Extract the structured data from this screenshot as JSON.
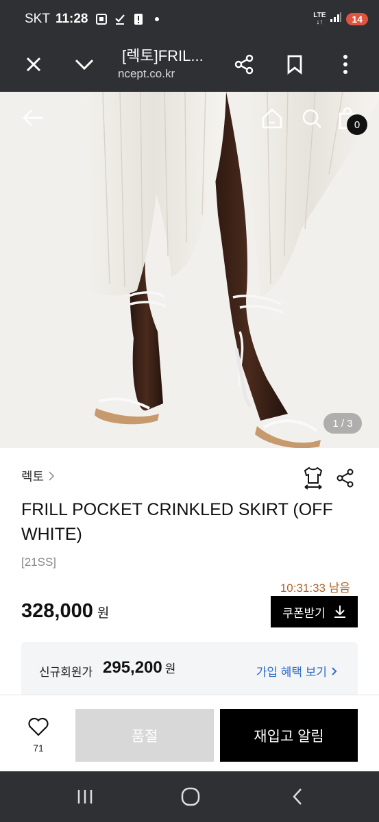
{
  "status_bar": {
    "carrier": "SKT",
    "time": "11:28",
    "network": "LTE",
    "battery": "14"
  },
  "browser": {
    "tab_title": "[렉토]FRIL...",
    "url": "ncept.co.kr"
  },
  "hero": {
    "cart_count": "0",
    "pager": "1 / 3"
  },
  "product": {
    "brand": "렉토",
    "title": "FRILL POCKET CRINKLED SKIRT (OFF WHITE)",
    "season": "[21SS]",
    "timer": "10:31:33 남음",
    "price": "328,000",
    "currency": "원",
    "coupon_label": "쿠폰받기"
  },
  "member": {
    "label": "신규회원가",
    "price": "295,200",
    "currency": "원",
    "link": "가입 혜택 보기"
  },
  "bottom": {
    "wish_count": "71",
    "soldout_label": "품절",
    "restock_label": "재입고 알림"
  },
  "colors": {
    "system_bar": "#2f3033",
    "timer": "#b0622b",
    "link": "#2f6cc7",
    "battery": "#e0533f"
  }
}
